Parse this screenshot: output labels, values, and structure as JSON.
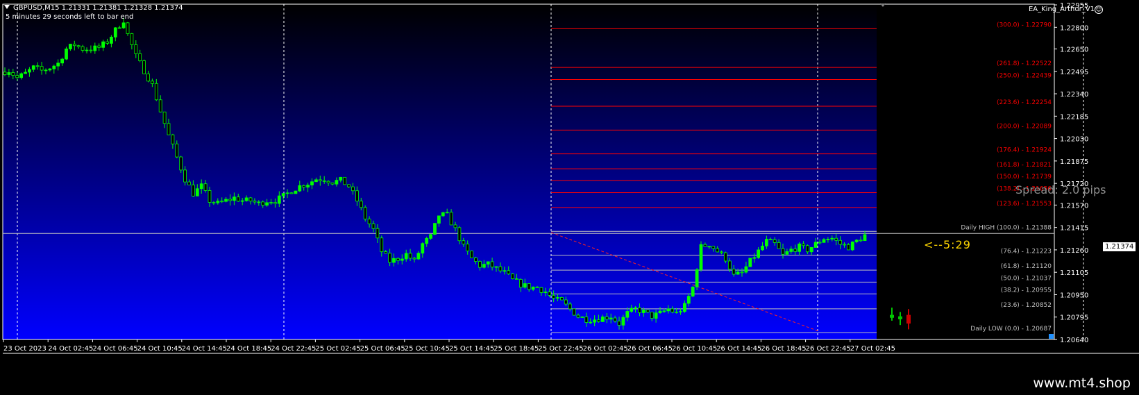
{
  "header": {
    "symbol_line": "GBPUSD,M15  1.21331 1.21381 1.21328 1.21374",
    "timer_line": "5 minutes 29 seconds left to bar end",
    "ea_name": "EA_King_Arthur_V1"
  },
  "overlay": {
    "spread": "Spread: 2.0 pips",
    "countdown": "<--5:29"
  },
  "watermark": "www.mt4.shop",
  "colors": {
    "background_top": "#000000",
    "background_bottom": "#0000ff",
    "candle_up": "#00ff00",
    "candle_down": "#00ff00",
    "fib_above": "#ff0000",
    "fib_below": "#c0c0c0",
    "spread_text": "#8f8f8f",
    "countdown_text": "#ffd700"
  },
  "chart_data": {
    "type": "candlestick",
    "symbol": "GBPUSD",
    "timeframe": "M15",
    "current_price": "1.21374",
    "ylim": [
      1.2064,
      1.2296
    ],
    "price_axis_ticks": [
      "1.22955",
      "1.22800",
      "1.22650",
      "1.22495",
      "1.22340",
      "1.22185",
      "1.22030",
      "1.21875",
      "1.21720",
      "1.21570",
      "1.21415",
      "1.21260",
      "1.21105",
      "1.20950",
      "1.20795",
      "1.20640"
    ],
    "time_axis_ticks": [
      "23 Oct 2023",
      "24 Oct 02:45",
      "24 Oct 06:45",
      "24 Oct 10:45",
      "24 Oct 14:45",
      "24 Oct 18:45",
      "24 Oct 22:45",
      "25 Oct 02:45",
      "25 Oct 06:45",
      "25 Oct 10:45",
      "25 Oct 14:45",
      "25 Oct 18:45",
      "25 Oct 22:45",
      "26 Oct 02:45",
      "26 Oct 06:45",
      "26 Oct 10:45",
      "26 Oct 14:45",
      "26 Oct 18:45",
      "26 Oct 22:45",
      "27 Oct 02:45"
    ],
    "close_path": [
      [
        0,
        1.2249
      ],
      [
        2,
        1.225
      ],
      [
        4,
        1.2245
      ],
      [
        6,
        1.2248
      ],
      [
        8,
        1.2252
      ],
      [
        10,
        1.225
      ],
      [
        12,
        1.2252
      ],
      [
        14,
        1.2255
      ],
      [
        16,
        1.2265
      ],
      [
        18,
        1.2268
      ],
      [
        20,
        1.2265
      ],
      [
        22,
        1.2265
      ],
      [
        24,
        1.2266
      ],
      [
        26,
        1.227
      ],
      [
        28,
        1.2278
      ],
      [
        30,
        1.2285
      ],
      [
        31,
        1.2275
      ],
      [
        33,
        1.226
      ],
      [
        35,
        1.225
      ],
      [
        37,
        1.224
      ],
      [
        39,
        1.2222
      ],
      [
        41,
        1.2205
      ],
      [
        43,
        1.219
      ],
      [
        45,
        1.2175
      ],
      [
        47,
        1.2165
      ],
      [
        49,
        1.217
      ],
      [
        51,
        1.216
      ],
      [
        53,
        1.2158
      ],
      [
        55,
        1.216
      ],
      [
        57,
        1.2162
      ],
      [
        59,
        1.216
      ],
      [
        61,
        1.216
      ],
      [
        63,
        1.2158
      ],
      [
        65,
        1.216
      ],
      [
        67,
        1.216
      ],
      [
        69,
        1.2163
      ],
      [
        71,
        1.2167
      ],
      [
        73,
        1.217
      ],
      [
        75,
        1.2172
      ],
      [
        77,
        1.2175
      ],
      [
        79,
        1.2175
      ],
      [
        81,
        1.2173
      ],
      [
        83,
        1.2174
      ],
      [
        85,
        1.217
      ],
      [
        87,
        1.216
      ],
      [
        89,
        1.2148
      ],
      [
        91,
        1.214
      ],
      [
        93,
        1.2125
      ],
      [
        95,
        1.2118
      ],
      [
        97,
        1.212
      ],
      [
        99,
        1.2123
      ],
      [
        101,
        1.2118
      ],
      [
        103,
        1.213
      ],
      [
        105,
        1.2135
      ],
      [
        107,
        1.215
      ],
      [
        109,
        1.215
      ],
      [
        111,
        1.214
      ],
      [
        113,
        1.2128
      ],
      [
        115,
        1.212
      ],
      [
        117,
        1.2115
      ],
      [
        119,
        1.2116
      ],
      [
        121,
        1.2113
      ],
      [
        123,
        1.211
      ],
      [
        125,
        1.2105
      ],
      [
        127,
        1.2102
      ],
      [
        129,
        1.21
      ],
      [
        131,
        1.21
      ],
      [
        133,
        1.2097
      ],
      [
        135,
        1.2092
      ],
      [
        137,
        1.209
      ],
      [
        139,
        1.2085
      ],
      [
        141,
        1.208
      ],
      [
        143,
        1.2078
      ],
      [
        145,
        1.2078
      ],
      [
        147,
        1.2079
      ],
      [
        149,
        1.208
      ],
      [
        151,
        1.2075
      ],
      [
        153,
        1.2082
      ],
      [
        155,
        1.2085
      ],
      [
        157,
        1.2083
      ],
      [
        159,
        1.208
      ],
      [
        161,
        1.2082
      ],
      [
        163,
        1.2085
      ],
      [
        165,
        1.2082
      ],
      [
        167,
        1.2087
      ],
      [
        169,
        1.21
      ],
      [
        171,
        1.2128
      ],
      [
        173,
        1.213
      ],
      [
        175,
        1.2125
      ],
      [
        177,
        1.212
      ],
      [
        179,
        1.2108
      ],
      [
        181,
        1.211
      ],
      [
        183,
        1.2118
      ],
      [
        185,
        1.2125
      ],
      [
        187,
        1.2132
      ],
      [
        189,
        1.213
      ],
      [
        191,
        1.2122
      ],
      [
        193,
        1.2126
      ],
      [
        195,
        1.2128
      ],
      [
        197,
        1.2126
      ],
      [
        199,
        1.213
      ],
      [
        201,
        1.2134
      ],
      [
        203,
        1.2134
      ],
      [
        205,
        1.213
      ],
      [
        207,
        1.2128
      ],
      [
        209,
        1.2132
      ],
      [
        211,
        1.2136
      ]
    ],
    "future_candles": [
      {
        "open": 1.2079,
        "high": 1.2086,
        "low": 1.2077,
        "close": 1.2081,
        "dir": "up"
      },
      {
        "open": 1.2078,
        "high": 1.2083,
        "low": 1.2074,
        "close": 1.208,
        "dir": "up"
      },
      {
        "open": 1.2081,
        "high": 1.2085,
        "low": 1.2071,
        "close": 1.2075,
        "dir": "down"
      }
    ],
    "fib_levels": [
      {
        "label": "(300.0) - 1.22790",
        "price": 1.2279,
        "above": true
      },
      {
        "label": "(261.8) - 1.22522",
        "price": 1.22522,
        "above": true
      },
      {
        "label": "(250.0) - 1.22439",
        "price": 1.22439,
        "above": true
      },
      {
        "label": "(223.6) - 1.22254",
        "price": 1.22254,
        "above": true
      },
      {
        "label": "(200.0) - 1.22089",
        "price": 1.22089,
        "above": true
      },
      {
        "label": "(176.4) - 1.21924",
        "price": 1.21924,
        "above": true
      },
      {
        "label": "(161.8) - 1.21821",
        "price": 1.21821,
        "above": true
      },
      {
        "label": "(150.0) - 1.21739",
        "price": 1.21739,
        "above": true
      },
      {
        "label": "(138.2) - 1.21656",
        "price": 1.21656,
        "above": true
      },
      {
        "label": "(123.6) - 1.21553",
        "price": 1.21553,
        "above": true
      },
      {
        "label": "Daily HIGH (100.0) - 1.21388",
        "price": 1.21388,
        "above": false
      },
      {
        "label": "(76.4) - 1.21223",
        "price": 1.21223,
        "above": false
      },
      {
        "label": "(61.8) - 1.21120",
        "price": 1.2112,
        "above": false
      },
      {
        "label": "(50.0) - 1.21037",
        "price": 1.21037,
        "above": false
      },
      {
        "label": "(38.2) - 1.20955",
        "price": 1.20955,
        "above": false
      },
      {
        "label": "(23.6) - 1.20852",
        "price": 1.20852,
        "above": false
      },
      {
        "label": "Daily LOW (0.0) - 1.20687",
        "price": 1.20687,
        "above": false
      }
    ]
  }
}
